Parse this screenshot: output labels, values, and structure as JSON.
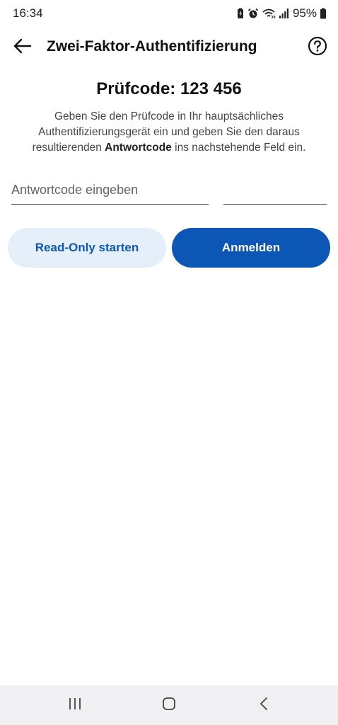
{
  "status_bar": {
    "time": "16:34",
    "battery_percent": "95%",
    "icons": [
      "battery-saver-icon",
      "alarm-icon",
      "wifi-icon",
      "signal-icon",
      "battery-icon"
    ]
  },
  "app_bar": {
    "title": "Zwei-Faktor-Authentifizierung",
    "back_icon": "arrow-left-icon",
    "help_icon": "help-circle-icon"
  },
  "main": {
    "code_heading": "Prüfcode: 123 456",
    "instructions_part1": "Geben Sie den Prüfcode in Ihr hauptsächliches Authentifizierungsgerät ein und geben Sie den daraus resultierenden ",
    "instructions_bold": "Antwortcode",
    "instructions_part2": " ins nachstehende Feld ein.",
    "input_placeholder": "Antwortcode eingeben",
    "secondary_button": "Read-Only starten",
    "primary_button": "Anmelden"
  },
  "colors": {
    "primary": "#0c56b5",
    "secondary_bg": "#e5eff9",
    "secondary_text": "#0e57b4"
  },
  "nav_bar": {
    "icons": [
      "recent-apps-icon",
      "home-icon",
      "back-nav-icon"
    ]
  }
}
